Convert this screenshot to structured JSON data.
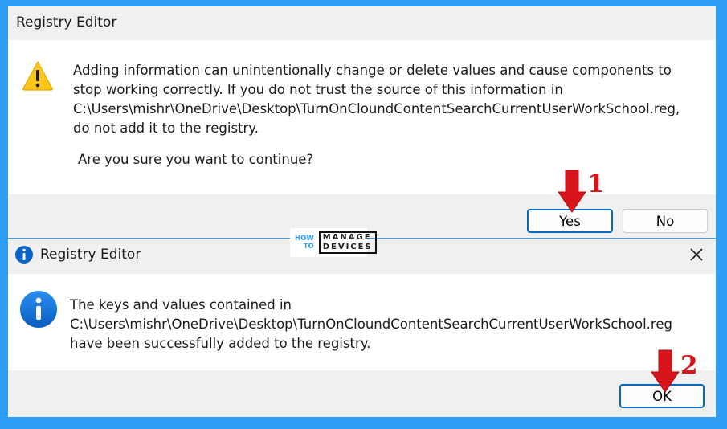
{
  "dialog_confirm": {
    "title": "Registry Editor",
    "message_lines": [
      "Adding information can unintentionally change or delete values and cause components to",
      "stop working correctly. If you do not trust the source of this information in",
      "C:\\Users\\mishr\\OneDrive\\Desktop\\TurnOnCloundContentSearchCurrentUserWorkSchool.reg,",
      "do not add it to the registry."
    ],
    "question": "Are you sure you want to continue?",
    "yes_label": "Yes",
    "no_label": "No",
    "icon": "warning-icon"
  },
  "dialog_success": {
    "title": "Registry Editor",
    "message_lines": [
      "The keys and values contained in",
      "C:\\Users\\mishr\\OneDrive\\Desktop\\TurnOnCloundContentSearchCurrentUserWorkSchool.reg",
      "have been successfully added to the registry."
    ],
    "ok_label": "OK",
    "icon": "info-icon"
  },
  "annotations": {
    "step1": "1",
    "step2": "2"
  },
  "logo": {
    "line1": "HOW",
    "line2": "TO",
    "box_line1": "MANAGE",
    "box_line2": "DEVICES"
  },
  "colors": {
    "background": "#2f9df4",
    "accent": "#0067c0",
    "annotation": "#d9141a",
    "warning": "#ffc61a"
  }
}
